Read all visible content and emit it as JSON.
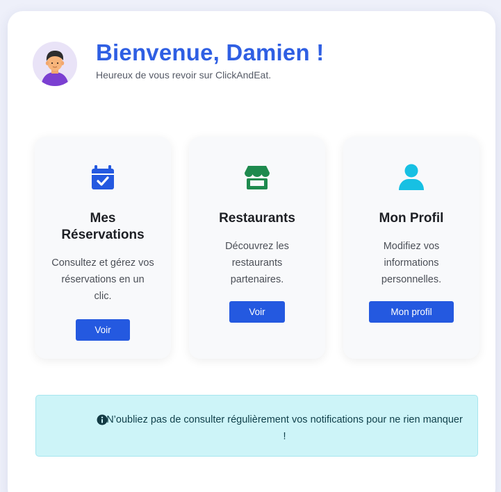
{
  "header": {
    "title": "Bienvenue, Damien !",
    "subtitle": "Heureux de vous revoir sur ClickAndEat."
  },
  "cards": [
    {
      "icon": "calendar-check-icon",
      "title": "Mes Réservations",
      "description": "Consultez et gérez vos réservations en un clic.",
      "button": "Voir",
      "accent": "#2459e0"
    },
    {
      "icon": "store-icon",
      "title": "Restaurants",
      "description": "Découvrez les restaurants partenaires.",
      "button": "Voir",
      "accent": "#1e8a4e"
    },
    {
      "icon": "user-icon",
      "title": "Mon Profil",
      "description": "Modifiez vos informations personnelles.",
      "button": "Mon profil",
      "accent": "#17c0e3"
    }
  ],
  "alert": {
    "icon": "info-circle-icon",
    "text": "N’oubliez pas de consulter régulièrement vos notifications pour ne rien manquer !"
  },
  "colors": {
    "primary": "#2f5fe3",
    "button": "#2459e0",
    "alert_bg": "#cdf4f8",
    "page_bg": "#eef0fa"
  }
}
